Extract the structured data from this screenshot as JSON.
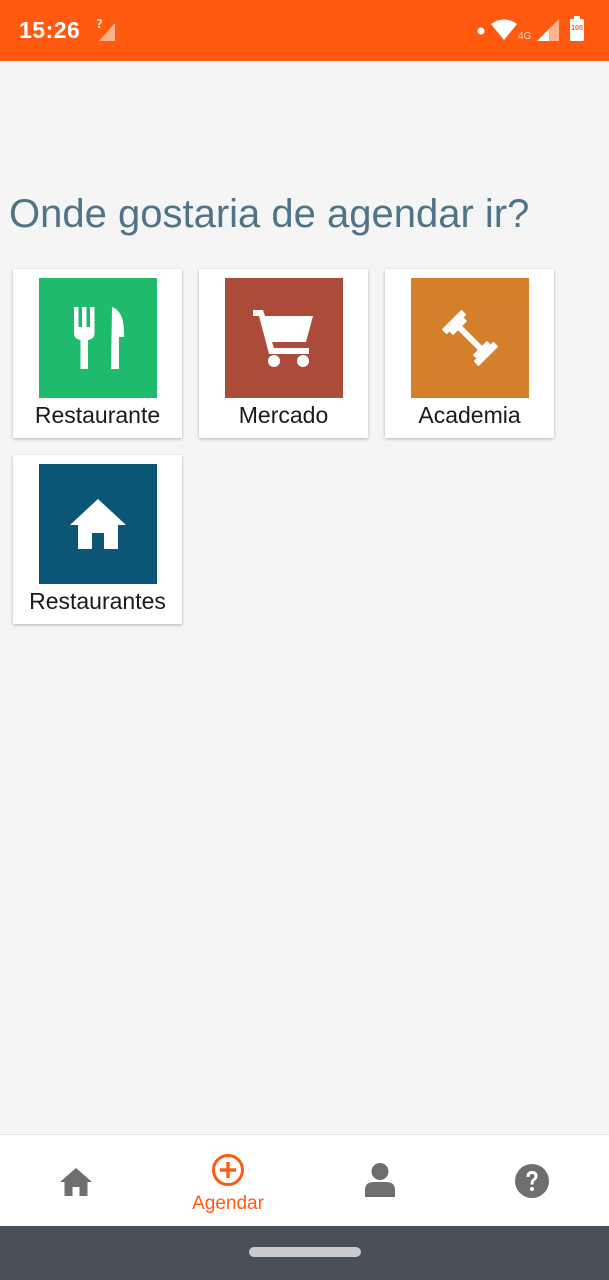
{
  "colors": {
    "status_bar": "#ff5a10",
    "title": "#4f7488",
    "accent": "#ff5a10",
    "nav_icon": "#6e6e6e",
    "system_bar": "#4a5057"
  },
  "status_bar": {
    "time": "15:26",
    "network_type": "4G",
    "battery": "100"
  },
  "page": {
    "title": "Onde gostaria de agendar ir?"
  },
  "categories": [
    {
      "label": "Restaurante",
      "icon": "fork-knife-icon",
      "color": "#1fba6c"
    },
    {
      "label": "Mercado",
      "icon": "shopping-cart-icon",
      "color": "#ad4b3a"
    },
    {
      "label": "Academia",
      "icon": "dumbbell-icon",
      "color": "#d37f2b"
    },
    {
      "label": "Restaurantes",
      "icon": "home-icon",
      "color": "#0b5677"
    }
  ],
  "bottom_nav": [
    {
      "icon": "home-icon",
      "label": ""
    },
    {
      "icon": "add-circle-icon",
      "label": "Agendar",
      "active": true
    },
    {
      "icon": "person-icon",
      "label": ""
    },
    {
      "icon": "help-icon",
      "label": ""
    }
  ]
}
